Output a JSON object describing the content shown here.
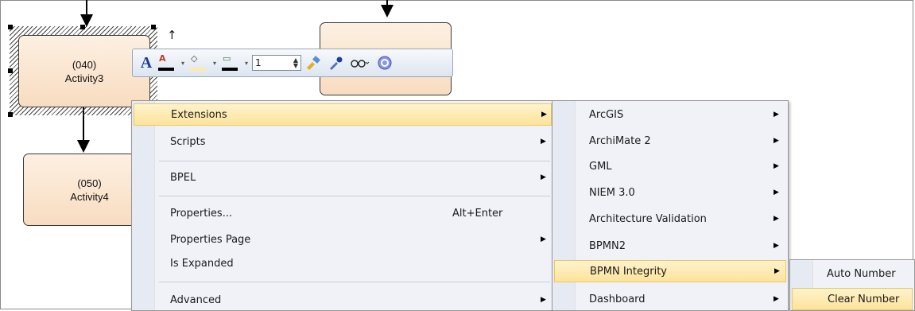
{
  "diagram": {
    "activities": [
      {
        "number": "(040)",
        "name": "Activity3"
      },
      {
        "number": "(050)",
        "name": "Activity4"
      }
    ]
  },
  "toolbar": {
    "font_icon": "A",
    "font_color_glyph": "A",
    "fill_color_glyph": "◇",
    "line_color_glyph": "▭",
    "line_width_value": "1",
    "buttons": [
      "font-icon",
      "font-color-icon",
      "fill-color-icon",
      "line-color-icon",
      "line-width-stepper",
      "format-painter-icon",
      "dropper-icon",
      "view-options-icon",
      "help-icon"
    ],
    "colors": {
      "font_bar": "#000000",
      "fill_bar": "#ffe8a8",
      "line_bar": "#000000"
    }
  },
  "context_menu": {
    "items": [
      {
        "label": "Extensions",
        "submenu": true,
        "highlighted": true
      },
      {
        "label": "Scripts",
        "submenu": true
      },
      {
        "label": "BPEL",
        "submenu": true
      },
      {
        "label": "Properties...",
        "accelerator": "Alt+Enter"
      },
      {
        "label": "Properties Page",
        "submenu": true
      },
      {
        "label": "Is Expanded"
      },
      {
        "label": "Advanced",
        "submenu": true
      }
    ]
  },
  "extensions_menu": {
    "items": [
      {
        "label": "ArcGIS",
        "submenu": true
      },
      {
        "label": "ArchiMate 2",
        "submenu": true
      },
      {
        "label": "GML",
        "submenu": true
      },
      {
        "label": "NIEM 3.0",
        "submenu": true
      },
      {
        "label": "Architecture Validation",
        "submenu": true
      },
      {
        "label": "BPMN2",
        "submenu": true
      },
      {
        "label": "BPMN Integrity",
        "submenu": true,
        "highlighted": true
      },
      {
        "label": "Dashboard",
        "submenu": true
      }
    ]
  },
  "bpmn_integrity_menu": {
    "items": [
      {
        "label": "Auto Number"
      },
      {
        "label": "Clear Number",
        "highlighted": true
      }
    ]
  },
  "glyphs": {
    "submenu_arrow": "▶",
    "dropdown": "▾"
  },
  "colors": {
    "highlight": "#fde39a",
    "menu_bg": "#f0f2f8",
    "activity_fill": "#f8dcc0"
  }
}
